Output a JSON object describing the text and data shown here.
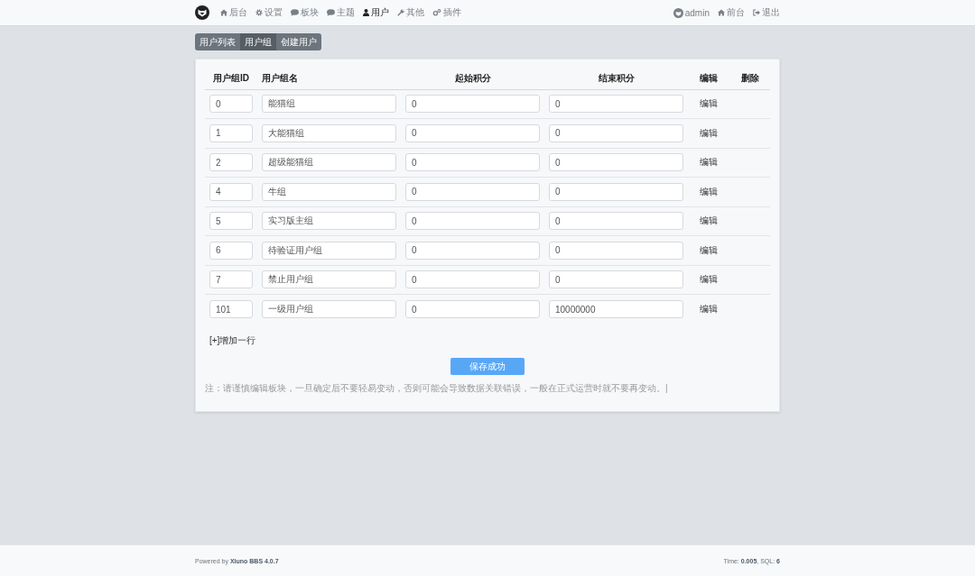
{
  "navbar": {
    "nav_items": [
      {
        "label": "后台",
        "selected": false
      },
      {
        "label": "设置",
        "selected": false
      },
      {
        "label": "板块",
        "selected": false
      },
      {
        "label": "主题",
        "selected": false
      },
      {
        "label": "用户",
        "selected": true
      },
      {
        "label": "其他",
        "selected": false
      },
      {
        "label": "插件",
        "selected": false
      }
    ],
    "right_items": [
      {
        "label": "admin"
      },
      {
        "label": "前台"
      },
      {
        "label": "退出"
      }
    ]
  },
  "tabs": [
    {
      "label": "用户列表",
      "selected": false
    },
    {
      "label": "用户组",
      "selected": true
    },
    {
      "label": "创建用户",
      "selected": false
    }
  ],
  "table": {
    "columns": [
      "用户组ID",
      "用户组名",
      "起始积分",
      "结束积分",
      "编辑",
      "删除"
    ],
    "rows": [
      {
        "id": "0",
        "name": "能猫组",
        "start": "0",
        "end": "0",
        "edit": "编辑"
      },
      {
        "id": "1",
        "name": "大能猫组",
        "start": "0",
        "end": "0",
        "edit": "编辑"
      },
      {
        "id": "2",
        "name": "超级能猫组",
        "start": "0",
        "end": "0",
        "edit": "编辑"
      },
      {
        "id": "4",
        "name": "牛组",
        "start": "0",
        "end": "0",
        "edit": "编辑"
      },
      {
        "id": "5",
        "name": "实习版主组",
        "start": "0",
        "end": "0",
        "edit": "编辑"
      },
      {
        "id": "6",
        "name": "待验证用户组",
        "start": "0",
        "end": "0",
        "edit": "编辑"
      },
      {
        "id": "7",
        "name": "禁止用户组",
        "start": "0",
        "end": "0",
        "edit": "编辑"
      },
      {
        "id": "101",
        "name": "一级用户组",
        "start": "0",
        "end": "10000000",
        "edit": "编辑"
      }
    ]
  },
  "add_row_link": "[+]增加一行",
  "save_button": "保存成功",
  "note": "注：请谨慎编辑板块，一旦确定后不要轻易变动，否则可能会导致数据关联错误，一般在正式运营时就不要再变动。|",
  "footer": {
    "powered_by": "Powered by **Xiuno BBS 4.0.7**",
    "stats": "Time: **0.005**, SQL: **6**"
  }
}
